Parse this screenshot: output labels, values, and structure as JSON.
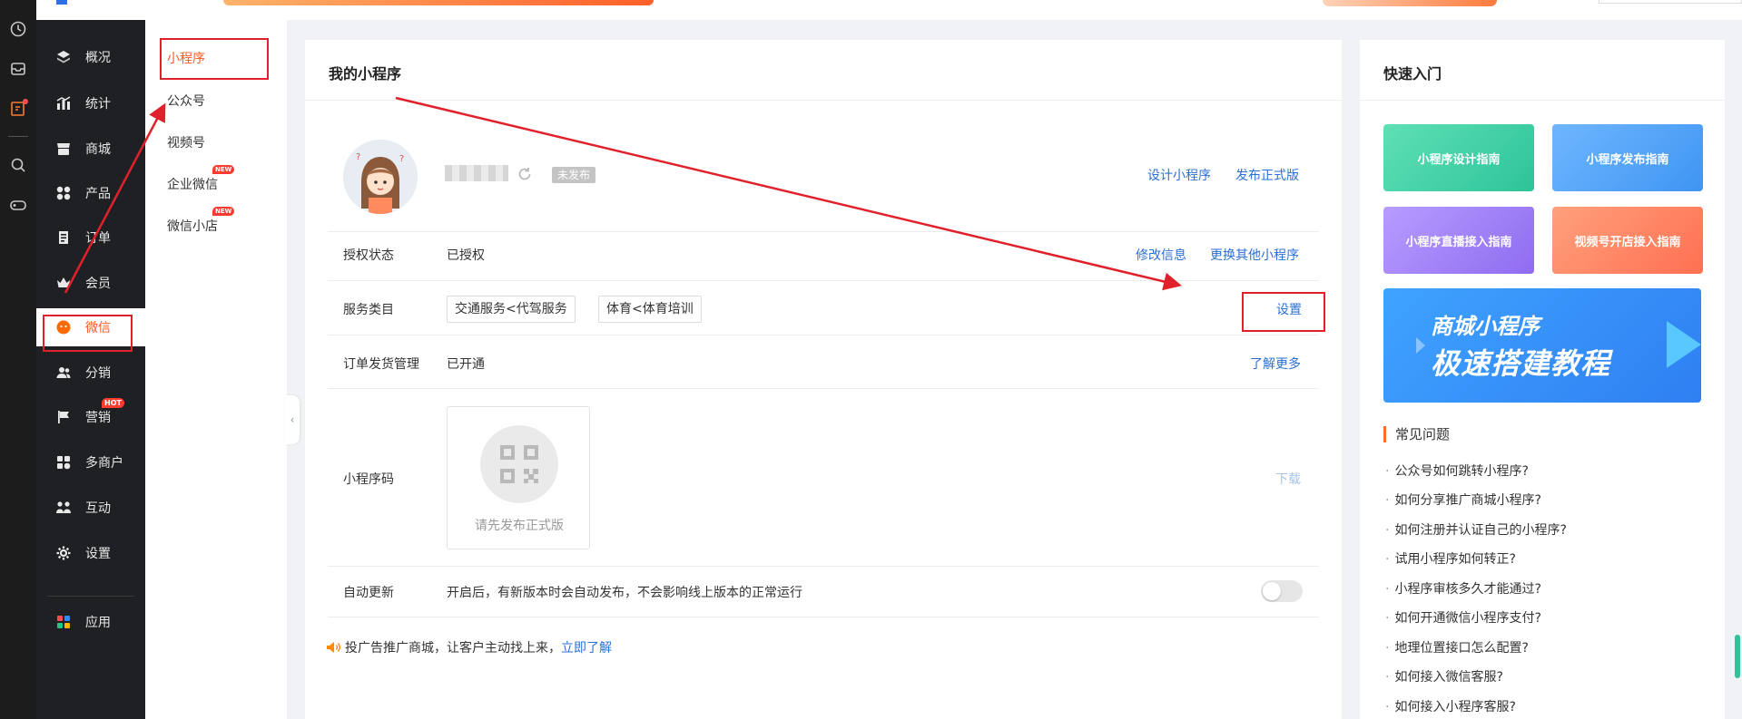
{
  "sidebar": {
    "items": [
      {
        "label": "概况",
        "icon": "layers-icon"
      },
      {
        "label": "统计",
        "icon": "chart-icon"
      },
      {
        "label": "商城",
        "icon": "store-icon"
      },
      {
        "label": "产品",
        "icon": "product-icon"
      },
      {
        "label": "订单",
        "icon": "order-icon"
      },
      {
        "label": "会员",
        "icon": "crown-icon"
      },
      {
        "label": "微信",
        "icon": "wechat-icon",
        "active": true
      },
      {
        "label": "分销",
        "icon": "users-icon"
      },
      {
        "label": "营销",
        "icon": "flag-icon",
        "badge": "HOT"
      },
      {
        "label": "多商户",
        "icon": "merchant-icon"
      },
      {
        "label": "互动",
        "icon": "interact-icon"
      },
      {
        "label": "设置",
        "icon": "gear-icon"
      },
      {
        "label": "应用",
        "icon": "apps-icon"
      }
    ]
  },
  "subnav": {
    "items": [
      {
        "label": "小程序",
        "active": true
      },
      {
        "label": "公众号"
      },
      {
        "label": "视频号"
      },
      {
        "label": "企业微信",
        "badge": "NEW"
      },
      {
        "label": "微信小店",
        "badge": "NEW"
      }
    ]
  },
  "main": {
    "title": "我的小程序",
    "status_tag": "未发布",
    "actions": {
      "design": "设计小程序",
      "publish": "发布正式版"
    },
    "auth": {
      "label": "授权状态",
      "value": "已授权",
      "edit": "修改信息",
      "switch": "更换其他小程序"
    },
    "service": {
      "label": "服务类目",
      "tags": [
        "交通服务<代驾服务",
        "体育<体育培训"
      ],
      "action": "设置"
    },
    "order": {
      "label": "订单发货管理",
      "value": "已开通",
      "action": "了解更多"
    },
    "qrcode": {
      "label": "小程序码",
      "placeholder": "请先发布正式版",
      "action": "下载"
    },
    "autoupdate": {
      "label": "自动更新",
      "desc": "开启后，有新版本时会自动发布，不会影响线上版本的正常运行",
      "enabled": false
    },
    "ad": {
      "text": "投广告推广商城，让客户主动找上来，",
      "link": "立即了解"
    }
  },
  "quick": {
    "title": "快速入门",
    "tiles": [
      "小程序设计指南",
      "小程序发布指南",
      "小程序直播接入指南",
      "视频号开店接入指南"
    ],
    "banner": {
      "line1": "商城小程序",
      "line2": "极速搭建教程"
    },
    "faq_title": "常见问题",
    "faq": [
      "公众号如何跳转小程序?",
      "如何分享推广商城小程序?",
      "如何注册并认证自己的小程序?",
      "试用小程序如何转正?",
      "小程序审核多久才能通过?",
      "如何开通微信小程序支付?",
      "地理位置接口怎么配置?",
      "如何接入微信客服?",
      "如何接入小程序客服?"
    ]
  },
  "colors": {
    "accent": "#ff5a1f",
    "link": "#2b6fd6",
    "annotation": "#e0202a"
  }
}
